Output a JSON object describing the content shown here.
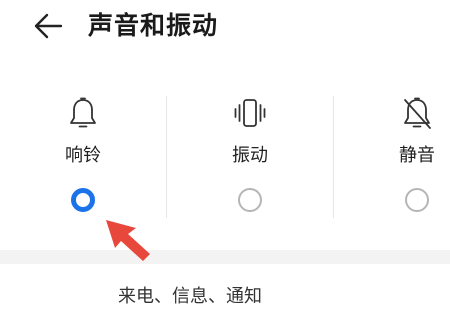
{
  "header": {
    "back_icon": "arrow-left-icon",
    "title": "声音和振动"
  },
  "modes": [
    {
      "label": "响铃",
      "icon": "bell-icon",
      "selected": true
    },
    {
      "label": "振动",
      "icon": "vibrate-icon",
      "selected": false
    },
    {
      "label": "静音",
      "icon": "bell-off-icon",
      "selected": false
    }
  ],
  "colors": {
    "accent": "#1a73e8",
    "annotation_arrow": "#e8483b"
  },
  "bottom": {
    "text": "来电、信息、通知"
  }
}
